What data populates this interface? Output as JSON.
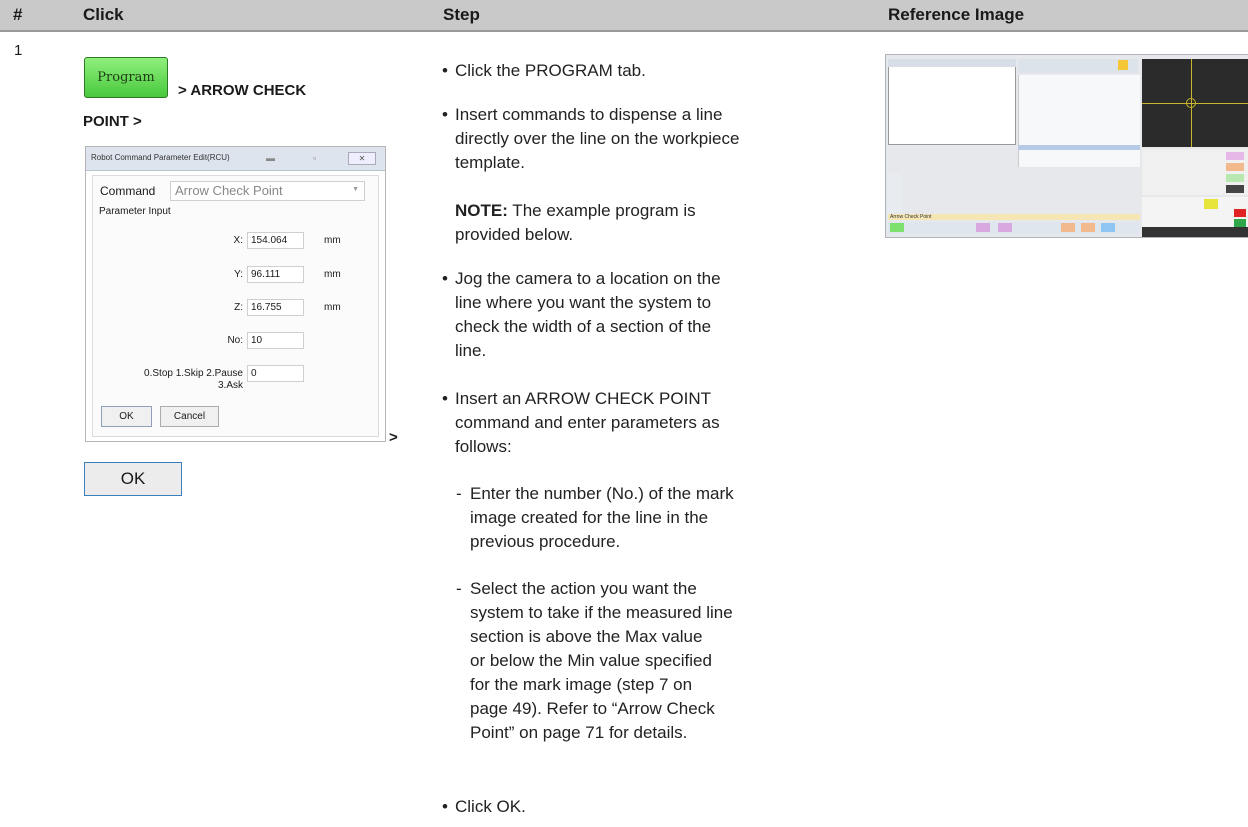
{
  "header": {
    "col_num": "#",
    "col_click": "Click",
    "col_step": "Step",
    "col_ref": "Reference Image"
  },
  "row": {
    "number": "1",
    "click": {
      "program_button": "Program",
      "text1": "> ARROW CHECK",
      "text2": "POINT >",
      "gt": ">",
      "ok_button": "OK",
      "dialog": {
        "title": "Robot Command Parameter Edit(RCU)",
        "command_label": "Command",
        "command_value": "Arrow Check Point",
        "param_input": "Parameter Input",
        "fields": [
          {
            "label": "X:",
            "value": "154.064",
            "unit": "mm"
          },
          {
            "label": "Y:",
            "value": "96.111",
            "unit": "mm"
          },
          {
            "label": "Z:",
            "value": "16.755",
            "unit": "mm"
          },
          {
            "label": "No:",
            "value": "10",
            "unit": ""
          }
        ],
        "stop_label_1": "0.Stop 1.Skip 2.Pause",
        "stop_label_2": "3.Ask",
        "stop_value": "0",
        "ok": "OK",
        "cancel": "Cancel"
      }
    },
    "step": {
      "b1": "Click the PROGRAM tab.",
      "b2_lines": [
        "Insert commands to dispense a line",
        "directly over the line on the workpiece",
        "template."
      ],
      "note_label": "NOTE:",
      "note_rest": " The example program is",
      "note_line2": "provided below.",
      "b3_lines": [
        "Jog the camera to a location on the",
        "line where you want the system to",
        "check the width of a section of the",
        "line."
      ],
      "b4_lines": [
        "Insert an ARROW CHECK POINT",
        "command and enter parameters as",
        "follows:"
      ],
      "s1_lines": [
        "Enter the number (No.) of the mark",
        "image created for the line in the",
        "previous procedure."
      ],
      "s2_lines": [
        "Select the action you want the",
        "system to take if the measured line",
        "section is above the Max value",
        "or below the Min value specified",
        "for the mark image (step 7 on",
        "page 49). Refer to “Arrow Check",
        "Point” on page 71 for details."
      ],
      "b5": "Click OK."
    },
    "reference": {
      "status": "Arrow Check Point"
    }
  }
}
